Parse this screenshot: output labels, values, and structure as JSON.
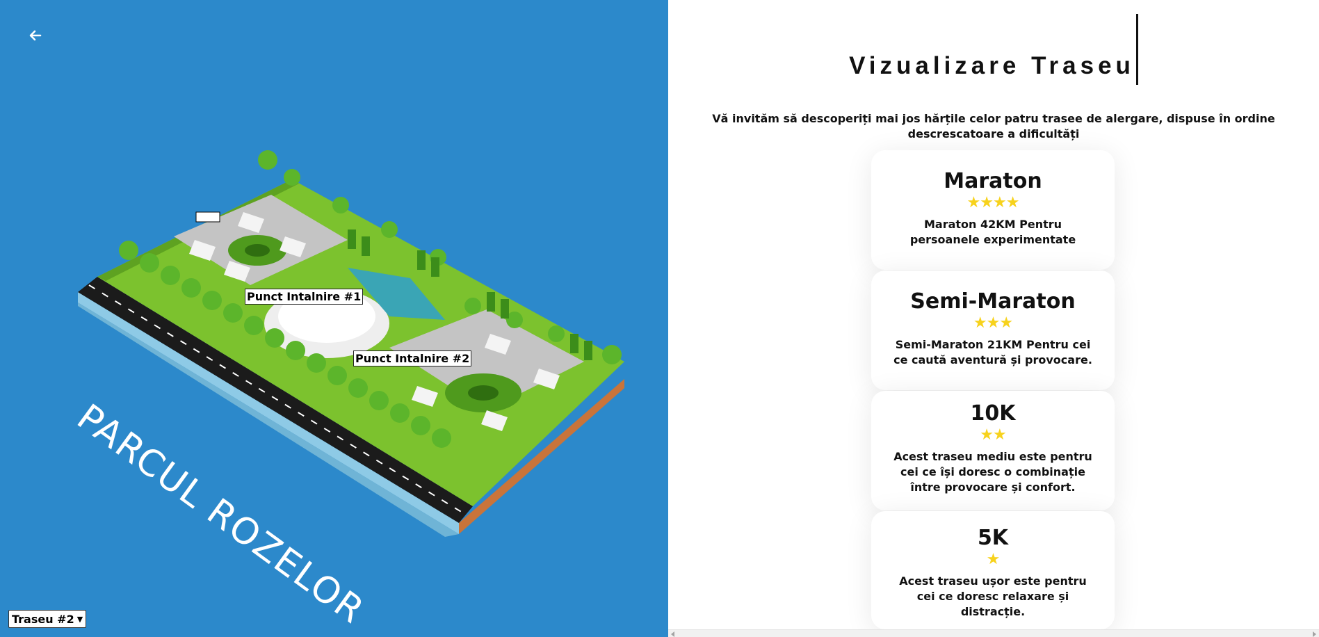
{
  "colors": {
    "map_background": "#2c89cb",
    "star": "#f7d21c",
    "grass": "#7cc22e",
    "road": "#1b1b1b",
    "water": "#8ecae6"
  },
  "map": {
    "back_icon": "arrow-left-icon",
    "park_name": "PARCUL ROZELOR",
    "markers": [
      {
        "label": "Punct Intalnire #1"
      },
      {
        "label": "Punct Intalnire #2"
      }
    ],
    "route_select": {
      "selected": "Traseu #2",
      "icon": "chevron-down-icon"
    }
  },
  "info": {
    "title": "Vizualizare Traseu",
    "intro": "Vă invităm să descoperiți mai jos hărțile celor patru trasee de alergare, dispuse în ordine descrescatoare a dificultăți",
    "routes": [
      {
        "name": "Maraton",
        "stars": "★★★★",
        "rating": 4,
        "description": "Maraton 42KM Pentru persoanele experimentate"
      },
      {
        "name": "Semi-Maraton",
        "stars": "★★★",
        "rating": 3,
        "description": "Semi-Maraton 21KM Pentru cei ce caută aventură și provocare."
      },
      {
        "name": "10K",
        "stars": "★★",
        "rating": 2,
        "description": "Acest traseu mediu este pentru cei ce își doresc o combinație între provocare și confort."
      },
      {
        "name": "5K",
        "stars": "★",
        "rating": 1,
        "description": "Acest traseu ușor este pentru cei ce doresc relaxare și distracție."
      }
    ]
  }
}
